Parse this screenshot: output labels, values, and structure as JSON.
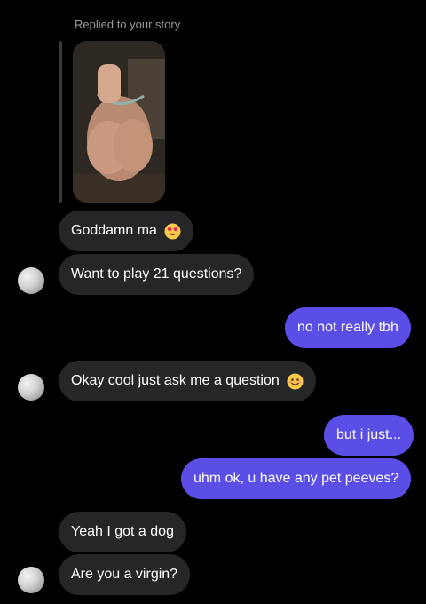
{
  "reply_caption": "Replied to your story",
  "messages": [
    {
      "text": "Goddamn ma",
      "emoji": "heart-eyes-emoji"
    },
    {
      "text": "Want to play 21 questions?"
    },
    {
      "text": "no not really tbh"
    },
    {
      "text": "Okay cool just ask me a question",
      "emoji": "smiling-emoji"
    },
    {
      "text": "but i just..."
    },
    {
      "text": "uhm ok, u have any pet peeves?"
    },
    {
      "text": "Yeah I got a dog"
    },
    {
      "text": "Are you a virgin?"
    }
  ],
  "colors": {
    "background": "#000000",
    "incoming_bubble": "#262628",
    "outgoing_bubble": "#5a4ee6",
    "caption_text": "#9a9a9a"
  }
}
